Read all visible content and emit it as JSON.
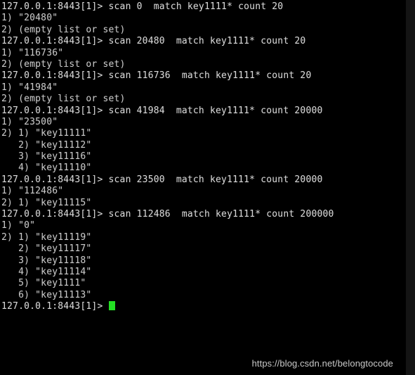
{
  "terminal": {
    "title": "redis-cli session",
    "prompt": "127.0.0.1:8443[1]> ",
    "cursor_color": "#23e023",
    "foreground_color": "#d0d0d0",
    "background_color": "#000000",
    "lines": [
      {
        "type": "command",
        "text": "127.0.0.1:8443[1]> scan 0  match key1111* count 20"
      },
      {
        "type": "output",
        "text": "1) \"20480\""
      },
      {
        "type": "output",
        "text": "2) (empty list or set)"
      },
      {
        "type": "command",
        "text": "127.0.0.1:8443[1]> scan 20480  match key1111* count 20"
      },
      {
        "type": "output",
        "text": "1) \"116736\""
      },
      {
        "type": "output",
        "text": "2) (empty list or set)"
      },
      {
        "type": "command",
        "text": "127.0.0.1:8443[1]> scan 116736  match key1111* count 20"
      },
      {
        "type": "output",
        "text": "1) \"41984\""
      },
      {
        "type": "output",
        "text": "2) (empty list or set)"
      },
      {
        "type": "command",
        "text": "127.0.0.1:8443[1]> scan 41984  match key1111* count 20000"
      },
      {
        "type": "output",
        "text": "1) \"23500\""
      },
      {
        "type": "output",
        "text": "2) 1) \"key11111\""
      },
      {
        "type": "output",
        "text": "   2) \"key11112\""
      },
      {
        "type": "output",
        "text": "   3) \"key11116\""
      },
      {
        "type": "output",
        "text": "   4) \"key11110\""
      },
      {
        "type": "command",
        "text": "127.0.0.1:8443[1]> scan 23500  match key1111* count 20000"
      },
      {
        "type": "output",
        "text": "1) \"112486\""
      },
      {
        "type": "output",
        "text": "2) 1) \"key11115\""
      },
      {
        "type": "command",
        "text": "127.0.0.1:8443[1]> scan 112486  match key1111* count 200000"
      },
      {
        "type": "output",
        "text": "1) \"0\""
      },
      {
        "type": "output",
        "text": "2) 1) \"key11119\""
      },
      {
        "type": "output",
        "text": "   2) \"key11117\""
      },
      {
        "type": "output",
        "text": "   3) \"key11118\""
      },
      {
        "type": "output",
        "text": "   4) \"key11114\""
      },
      {
        "type": "output",
        "text": "   5) \"key1111\""
      },
      {
        "type": "output",
        "text": "   6) \"key11113\""
      }
    ],
    "final_prompt": "127.0.0.1:8443[1]> "
  },
  "watermark": {
    "text": "https://blog.csdn.net/belongtocode"
  }
}
